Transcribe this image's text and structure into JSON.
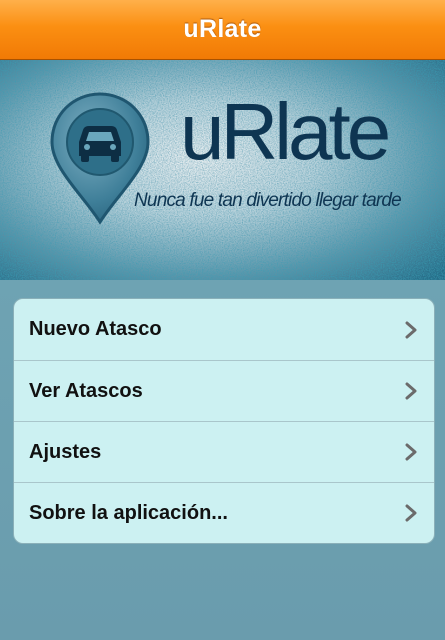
{
  "navbar": {
    "title": "uRlate"
  },
  "banner": {
    "logo_text": "uRlate",
    "tagline": "Nunca fue tan divertido llegar tarde",
    "pin_icon": "car-pin-icon"
  },
  "menu": {
    "items": [
      {
        "label": "Nuevo Atasco",
        "icon": "chevron-right-icon"
      },
      {
        "label": "Ver Atascos",
        "icon": "chevron-right-icon"
      },
      {
        "label": "Ajustes",
        "icon": "chevron-right-icon"
      },
      {
        "label": "Sobre la aplicación...",
        "icon": "chevron-right-icon"
      }
    ]
  },
  "colors": {
    "navbar": "#f88a0e",
    "banner": "#5d93a6",
    "logo": "#0e3552",
    "menu_bg": "#ccf1f2",
    "page_bg": "#6a9aa8"
  }
}
